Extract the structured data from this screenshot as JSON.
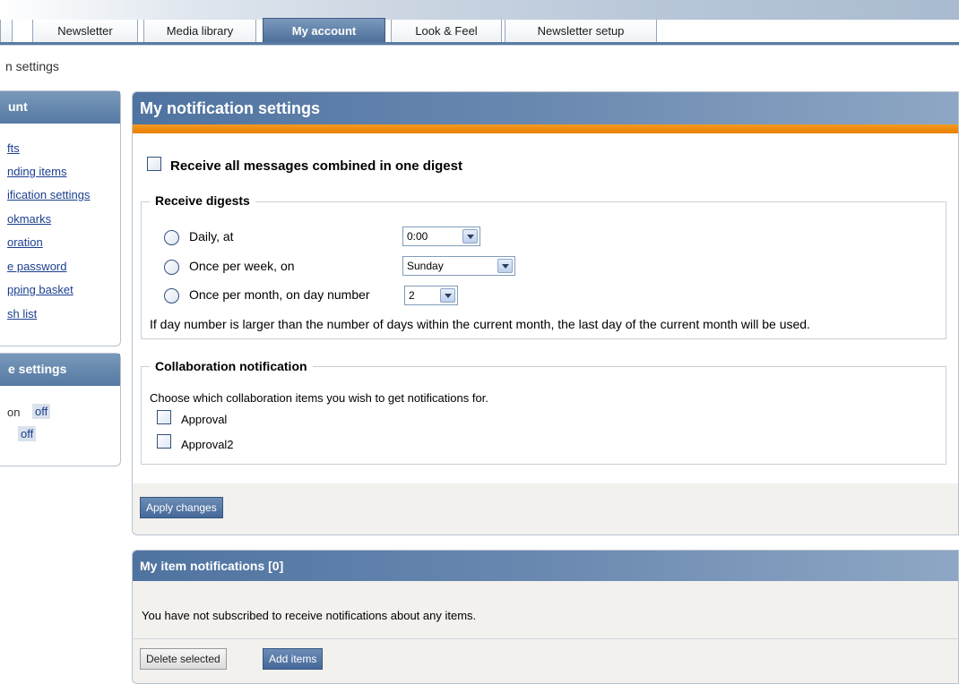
{
  "tabs": [
    {
      "label": "Newsletter"
    },
    {
      "label": "Media library"
    },
    {
      "label": "My account",
      "active": true
    },
    {
      "label": "Look & Feel"
    },
    {
      "label": "Newsletter setup"
    }
  ],
  "breadcrumb": "n settings",
  "sidebar": {
    "account": {
      "title": "unt",
      "items": [
        {
          "label": "fts"
        },
        {
          "label": "nding items"
        },
        {
          "label": "ification settings"
        },
        {
          "label": "okmarks"
        },
        {
          "label": "oration"
        },
        {
          "label": "e password"
        },
        {
          "label": "pping basket"
        },
        {
          "label": "sh list"
        }
      ]
    },
    "settings": {
      "title": "e settings",
      "rows": [
        {
          "label": "on",
          "value": "off"
        },
        {
          "label": "",
          "value": "off"
        }
      ]
    }
  },
  "notifications": {
    "title": "My notification settings",
    "digest_all_label": "Receive all messages combined in one digest",
    "receive_digests": {
      "legend": "Receive digests",
      "daily_label": "Daily, at",
      "daily_value": "0:00",
      "weekly_label": "Once per week, on",
      "weekly_value": "Sunday",
      "monthly_label": "Once per month, on day number",
      "monthly_value": "2",
      "note": "If day number is larger than the number of days within the current month, the last day of the current month will be used."
    },
    "collaboration": {
      "legend": "Collaboration notification",
      "intro": "Choose which collaboration items you wish to get notifications for.",
      "items": [
        {
          "label": "Approval"
        },
        {
          "label": "Approval2"
        }
      ]
    },
    "apply_label": "Apply changes"
  },
  "item_notifications": {
    "title": "My item notifications [0]",
    "empty_text": "You have not subscribed to receive notifications about any items.",
    "delete_label": "Delete selected",
    "add_label": "Add items"
  }
}
